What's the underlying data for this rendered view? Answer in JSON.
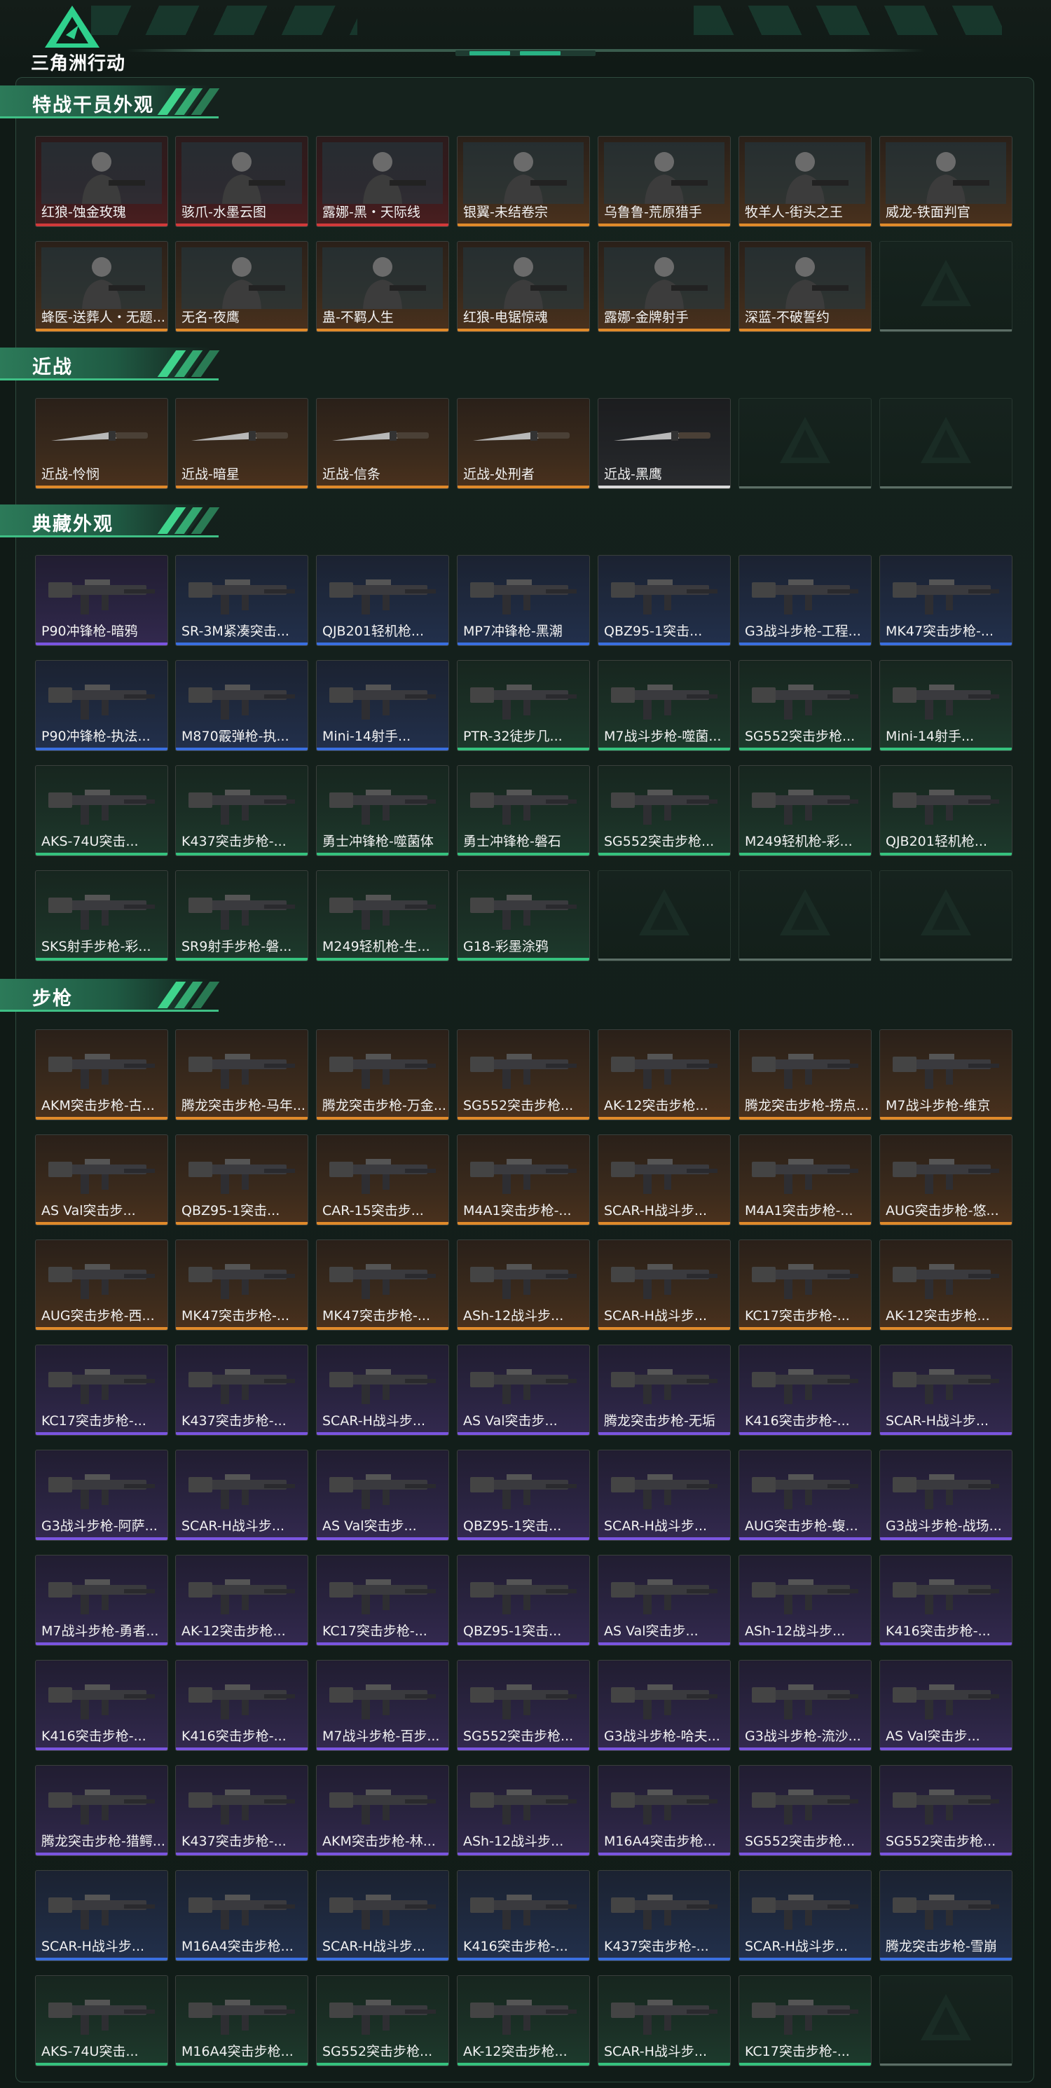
{
  "header": {
    "logo_text": "三角洲行动",
    "logo_icon": "delta-triangle-logo",
    "accent_color": "#3fd48c"
  },
  "sections": [
    {
      "title": "特战干员外观",
      "items": [
        {
          "name": "红狼-蚀金玫瑰",
          "quality": "red",
          "icon": "operator-portrait"
        },
        {
          "name": "骇爪-水墨云图",
          "quality": "red",
          "icon": "operator-portrait"
        },
        {
          "name": "露娜-黑・天际线",
          "quality": "red",
          "icon": "operator-portrait"
        },
        {
          "name": "银翼-未结卷宗",
          "quality": "orange",
          "icon": "operator-portrait"
        },
        {
          "name": "乌鲁鲁-荒原猎手",
          "quality": "orange",
          "icon": "operator-portrait"
        },
        {
          "name": "牧羊人-街头之王",
          "quality": "orange",
          "icon": "operator-portrait"
        },
        {
          "name": "威龙-铁面判官",
          "quality": "orange",
          "icon": "operator-portrait"
        },
        {
          "name": "蜂医-送葬人・无题...",
          "quality": "orange",
          "icon": "operator-portrait"
        },
        {
          "name": "无名-夜鹰",
          "quality": "orange",
          "icon": "operator-portrait"
        },
        {
          "name": "蛊-不羁人生",
          "quality": "orange",
          "icon": "operator-portrait"
        },
        {
          "name": "红狼-电锯惊魂",
          "quality": "orange",
          "icon": "operator-portrait"
        },
        {
          "name": "露娜-金牌射手",
          "quality": "orange",
          "icon": "operator-portrait"
        },
        {
          "name": "深蓝-不破誓约",
          "quality": "orange",
          "icon": "operator-portrait"
        }
      ]
    },
    {
      "title": "近战",
      "items": [
        {
          "name": "近战-怜悯",
          "quality": "orange",
          "icon": "knife-icon"
        },
        {
          "name": "近战-暗星",
          "quality": "orange",
          "icon": "knife-icon"
        },
        {
          "name": "近战-信条",
          "quality": "orange",
          "icon": "knife-icon"
        },
        {
          "name": "近战-处刑者",
          "quality": "orange",
          "icon": "knife-icon"
        },
        {
          "name": "近战-黑鹰",
          "quality": "white",
          "icon": "knife-icon"
        }
      ]
    },
    {
      "title": "典藏外观",
      "items": [
        {
          "name": "P90冲锋枪-暗鸦",
          "quality": "purple",
          "icon": "gun-icon"
        },
        {
          "name": "SR-3M紧凑突击...",
          "quality": "blue",
          "icon": "gun-icon"
        },
        {
          "name": "QJB201轻机枪...",
          "quality": "blue",
          "icon": "gun-icon"
        },
        {
          "name": "MP7冲锋枪-黑潮",
          "quality": "blue",
          "icon": "gun-icon"
        },
        {
          "name": "QBZ95-1突击...",
          "quality": "blue",
          "icon": "gun-icon"
        },
        {
          "name": "G3战斗步枪-工程...",
          "quality": "blue",
          "icon": "gun-icon"
        },
        {
          "name": "MK47突击步枪-...",
          "quality": "blue",
          "icon": "gun-icon"
        },
        {
          "name": "P90冲锋枪-执法...",
          "quality": "blue",
          "icon": "gun-icon"
        },
        {
          "name": "M870霰弹枪-执...",
          "quality": "blue",
          "icon": "gun-icon"
        },
        {
          "name": "Mini-14射手...",
          "quality": "blue",
          "icon": "gun-icon"
        },
        {
          "name": "PTR-32徒步几...",
          "quality": "green",
          "icon": "gun-icon"
        },
        {
          "name": "M7战斗步枪-噬菌...",
          "quality": "green",
          "icon": "gun-icon"
        },
        {
          "name": "SG552突击步枪...",
          "quality": "green",
          "icon": "gun-icon"
        },
        {
          "name": "Mini-14射手...",
          "quality": "green",
          "icon": "gun-icon"
        },
        {
          "name": "AKS-74U突击...",
          "quality": "green",
          "icon": "gun-icon"
        },
        {
          "name": "K437突击步枪-...",
          "quality": "green",
          "icon": "gun-icon"
        },
        {
          "name": "勇士冲锋枪-噬菌体",
          "quality": "green",
          "icon": "gun-icon"
        },
        {
          "name": "勇士冲锋枪-磐石",
          "quality": "green",
          "icon": "gun-icon"
        },
        {
          "name": "SG552突击步枪...",
          "quality": "green",
          "icon": "gun-icon"
        },
        {
          "name": "M249轻机枪-彩...",
          "quality": "green",
          "icon": "gun-icon"
        },
        {
          "name": "QJB201轻机枪...",
          "quality": "green",
          "icon": "gun-icon"
        },
        {
          "name": "SKS射手步枪-彩...",
          "quality": "green",
          "icon": "gun-icon"
        },
        {
          "name": "SR9射手步枪-磐...",
          "quality": "green",
          "icon": "gun-icon"
        },
        {
          "name": "M249轻机枪-生...",
          "quality": "green",
          "icon": "gun-icon"
        },
        {
          "name": "G18-彩墨涂鸦",
          "quality": "green",
          "icon": "gun-icon"
        }
      ]
    },
    {
      "title": "步枪",
      "items": [
        {
          "name": "AKM突击步枪-古...",
          "quality": "orange",
          "icon": "gun-icon"
        },
        {
          "name": "腾龙突击步枪-马年...",
          "quality": "orange",
          "icon": "gun-icon"
        },
        {
          "name": "腾龙突击步枪-万金...",
          "quality": "orange",
          "icon": "gun-icon"
        },
        {
          "name": "SG552突击步枪...",
          "quality": "orange",
          "icon": "gun-icon"
        },
        {
          "name": "AK-12突击步枪...",
          "quality": "orange",
          "icon": "gun-icon"
        },
        {
          "name": "腾龙突击步枪-捞点...",
          "quality": "orange",
          "icon": "gun-icon"
        },
        {
          "name": "M7战斗步枪-维京",
          "quality": "orange",
          "icon": "gun-icon"
        },
        {
          "name": "AS Val突击步...",
          "quality": "orange",
          "icon": "gun-icon"
        },
        {
          "name": "QBZ95-1突击...",
          "quality": "orange",
          "icon": "gun-icon"
        },
        {
          "name": "CAR-15突击步...",
          "quality": "orange",
          "icon": "gun-icon"
        },
        {
          "name": "M4A1突击步枪-...",
          "quality": "orange",
          "icon": "gun-icon"
        },
        {
          "name": "SCAR-H战斗步...",
          "quality": "orange",
          "icon": "gun-icon"
        },
        {
          "name": "M4A1突击步枪-...",
          "quality": "orange",
          "icon": "gun-icon"
        },
        {
          "name": "AUG突击步枪-悠...",
          "quality": "orange",
          "icon": "gun-icon"
        },
        {
          "name": "AUG突击步枪-西...",
          "quality": "orange",
          "icon": "gun-icon"
        },
        {
          "name": "MK47突击步枪-...",
          "quality": "orange",
          "icon": "gun-icon"
        },
        {
          "name": "MK47突击步枪-...",
          "quality": "orange",
          "icon": "gun-icon"
        },
        {
          "name": "ASh-12战斗步...",
          "quality": "orange",
          "icon": "gun-icon"
        },
        {
          "name": "SCAR-H战斗步...",
          "quality": "orange",
          "icon": "gun-icon"
        },
        {
          "name": "KC17突击步枪-...",
          "quality": "orange",
          "icon": "gun-icon"
        },
        {
          "name": "AK-12突击步枪...",
          "quality": "orange",
          "icon": "gun-icon"
        },
        {
          "name": "KC17突击步枪-...",
          "quality": "purple",
          "icon": "gun-icon"
        },
        {
          "name": "K437突击步枪-...",
          "quality": "purple",
          "icon": "gun-icon"
        },
        {
          "name": "SCAR-H战斗步...",
          "quality": "purple",
          "icon": "gun-icon"
        },
        {
          "name": "AS Val突击步...",
          "quality": "purple",
          "icon": "gun-icon"
        },
        {
          "name": "腾龙突击步枪-无垢",
          "quality": "purple",
          "icon": "gun-icon"
        },
        {
          "name": "K416突击步枪-...",
          "quality": "purple",
          "icon": "gun-icon"
        },
        {
          "name": "SCAR-H战斗步...",
          "quality": "purple",
          "icon": "gun-icon"
        },
        {
          "name": "G3战斗步枪-阿萨...",
          "quality": "purple",
          "icon": "gun-icon"
        },
        {
          "name": "SCAR-H战斗步...",
          "quality": "purple",
          "icon": "gun-icon"
        },
        {
          "name": "AS Val突击步...",
          "quality": "purple",
          "icon": "gun-icon"
        },
        {
          "name": "QBZ95-1突击...",
          "quality": "purple",
          "icon": "gun-icon"
        },
        {
          "name": "SCAR-H战斗步...",
          "quality": "purple",
          "icon": "gun-icon"
        },
        {
          "name": "AUG突击步枪-蝮...",
          "quality": "purple",
          "icon": "gun-icon"
        },
        {
          "name": "G3战斗步枪-战场...",
          "quality": "purple",
          "icon": "gun-icon"
        },
        {
          "name": "M7战斗步枪-勇者...",
          "quality": "purple",
          "icon": "gun-icon"
        },
        {
          "name": "AK-12突击步枪...",
          "quality": "purple",
          "icon": "gun-icon"
        },
        {
          "name": "KC17突击步枪-...",
          "quality": "purple",
          "icon": "gun-icon"
        },
        {
          "name": "QBZ95-1突击...",
          "quality": "purple",
          "icon": "gun-icon"
        },
        {
          "name": "AS Val突击步...",
          "quality": "purple",
          "icon": "gun-icon"
        },
        {
          "name": "ASh-12战斗步...",
          "quality": "purple",
          "icon": "gun-icon"
        },
        {
          "name": "K416突击步枪-...",
          "quality": "purple",
          "icon": "gun-icon"
        },
        {
          "name": "K416突击步枪-...",
          "quality": "purple",
          "icon": "gun-icon"
        },
        {
          "name": "K416突击步枪-...",
          "quality": "purple",
          "icon": "gun-icon"
        },
        {
          "name": "M7战斗步枪-百步...",
          "quality": "purple",
          "icon": "gun-icon"
        },
        {
          "name": "SG552突击步枪...",
          "quality": "purple",
          "icon": "gun-icon"
        },
        {
          "name": "G3战斗步枪-哈夫...",
          "quality": "purple",
          "icon": "gun-icon"
        },
        {
          "name": "G3战斗步枪-流沙...",
          "quality": "purple",
          "icon": "gun-icon"
        },
        {
          "name": "AS Val突击步...",
          "quality": "purple",
          "icon": "gun-icon"
        },
        {
          "name": "腾龙突击步枪-猎鳄...",
          "quality": "purple",
          "icon": "gun-icon"
        },
        {
          "name": "K437突击步枪-...",
          "quality": "purple",
          "icon": "gun-icon"
        },
        {
          "name": "AKM突击步枪-林...",
          "quality": "purple",
          "icon": "gun-icon"
        },
        {
          "name": "ASh-12战斗步...",
          "quality": "purple",
          "icon": "gun-icon"
        },
        {
          "name": "M16A4突击步枪...",
          "quality": "purple",
          "icon": "gun-icon"
        },
        {
          "name": "SG552突击步枪...",
          "quality": "purple",
          "icon": "gun-icon"
        },
        {
          "name": "SG552突击步枪...",
          "quality": "purple",
          "icon": "gun-icon"
        },
        {
          "name": "SCAR-H战斗步...",
          "quality": "blue",
          "icon": "gun-icon"
        },
        {
          "name": "M16A4突击步枪...",
          "quality": "blue",
          "icon": "gun-icon"
        },
        {
          "name": "SCAR-H战斗步...",
          "quality": "blue",
          "icon": "gun-icon"
        },
        {
          "name": "K416突击步枪-...",
          "quality": "blue",
          "icon": "gun-icon"
        },
        {
          "name": "K437突击步枪-...",
          "quality": "blue",
          "icon": "gun-icon"
        },
        {
          "name": "SCAR-H战斗步...",
          "quality": "blue",
          "icon": "gun-icon"
        },
        {
          "name": "腾龙突击步枪-雪崩",
          "quality": "blue",
          "icon": "gun-icon"
        },
        {
          "name": "AKS-74U突击...",
          "quality": "green",
          "icon": "gun-icon"
        },
        {
          "name": "M16A4突击步枪...",
          "quality": "green",
          "icon": "gun-icon"
        },
        {
          "name": "SG552突击步枪...",
          "quality": "green",
          "icon": "gun-icon"
        },
        {
          "name": "AK-12突击步枪...",
          "quality": "green",
          "icon": "gun-icon"
        },
        {
          "name": "SCAR-H战斗步...",
          "quality": "green",
          "icon": "gun-icon"
        },
        {
          "name": "KC17突击步枪-...",
          "quality": "green",
          "icon": "gun-icon"
        }
      ]
    }
  ],
  "quality_colors": {
    "red": "#d23a3a",
    "orange": "#e08a2a",
    "purple": "#7a55e0",
    "blue": "#3a6fe0",
    "green": "#35c27e",
    "white": "#d9d9d9"
  }
}
